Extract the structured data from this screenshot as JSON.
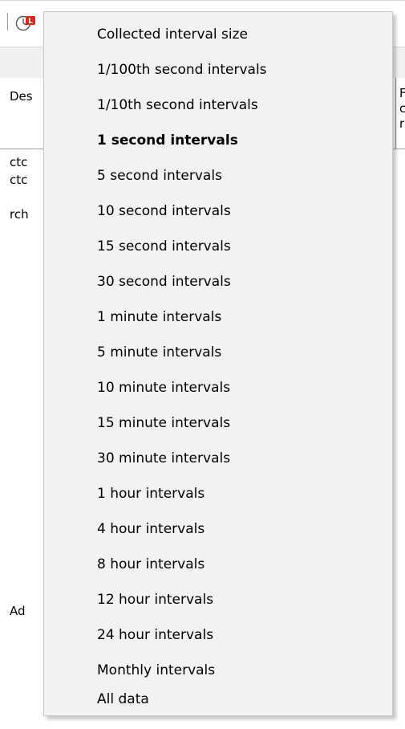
{
  "background": {
    "header_desc": "Des",
    "header_right_col": [
      "F",
      "c",
      "r"
    ],
    "rows": [
      "ctc",
      "ctc",
      "rch",
      "Ad"
    ]
  },
  "menu": {
    "selected_index": 3,
    "items": [
      {
        "label": "Collected interval size",
        "bold": false
      },
      {
        "label": "1/100th second intervals",
        "bold": false
      },
      {
        "label": "1/10th second intervals",
        "bold": false
      },
      {
        "label": "1 second intervals",
        "bold": true
      },
      {
        "label": "5 second intervals",
        "bold": false
      },
      {
        "label": "10 second intervals",
        "bold": false
      },
      {
        "label": "15 second intervals",
        "bold": false
      },
      {
        "label": "30 second intervals",
        "bold": false
      },
      {
        "label": "1 minute intervals",
        "bold": false
      },
      {
        "label": "5 minute intervals",
        "bold": false
      },
      {
        "label": "10 minute intervals",
        "bold": false
      },
      {
        "label": "15 minute intervals",
        "bold": false
      },
      {
        "label": "30 minute intervals",
        "bold": false
      },
      {
        "label": "1 hour intervals",
        "bold": false
      },
      {
        "label": "4 hour intervals",
        "bold": false
      },
      {
        "label": "8 hour intervals",
        "bold": false
      },
      {
        "label": "12 hour intervals",
        "bold": false
      },
      {
        "label": "24 hour intervals",
        "bold": false
      },
      {
        "label": "Monthly intervals",
        "bold": false
      },
      {
        "label": "All data",
        "bold": false
      }
    ]
  },
  "colors": {
    "menu_background": "#f2f2f2",
    "clock_icon_red": "#d42a1e"
  }
}
